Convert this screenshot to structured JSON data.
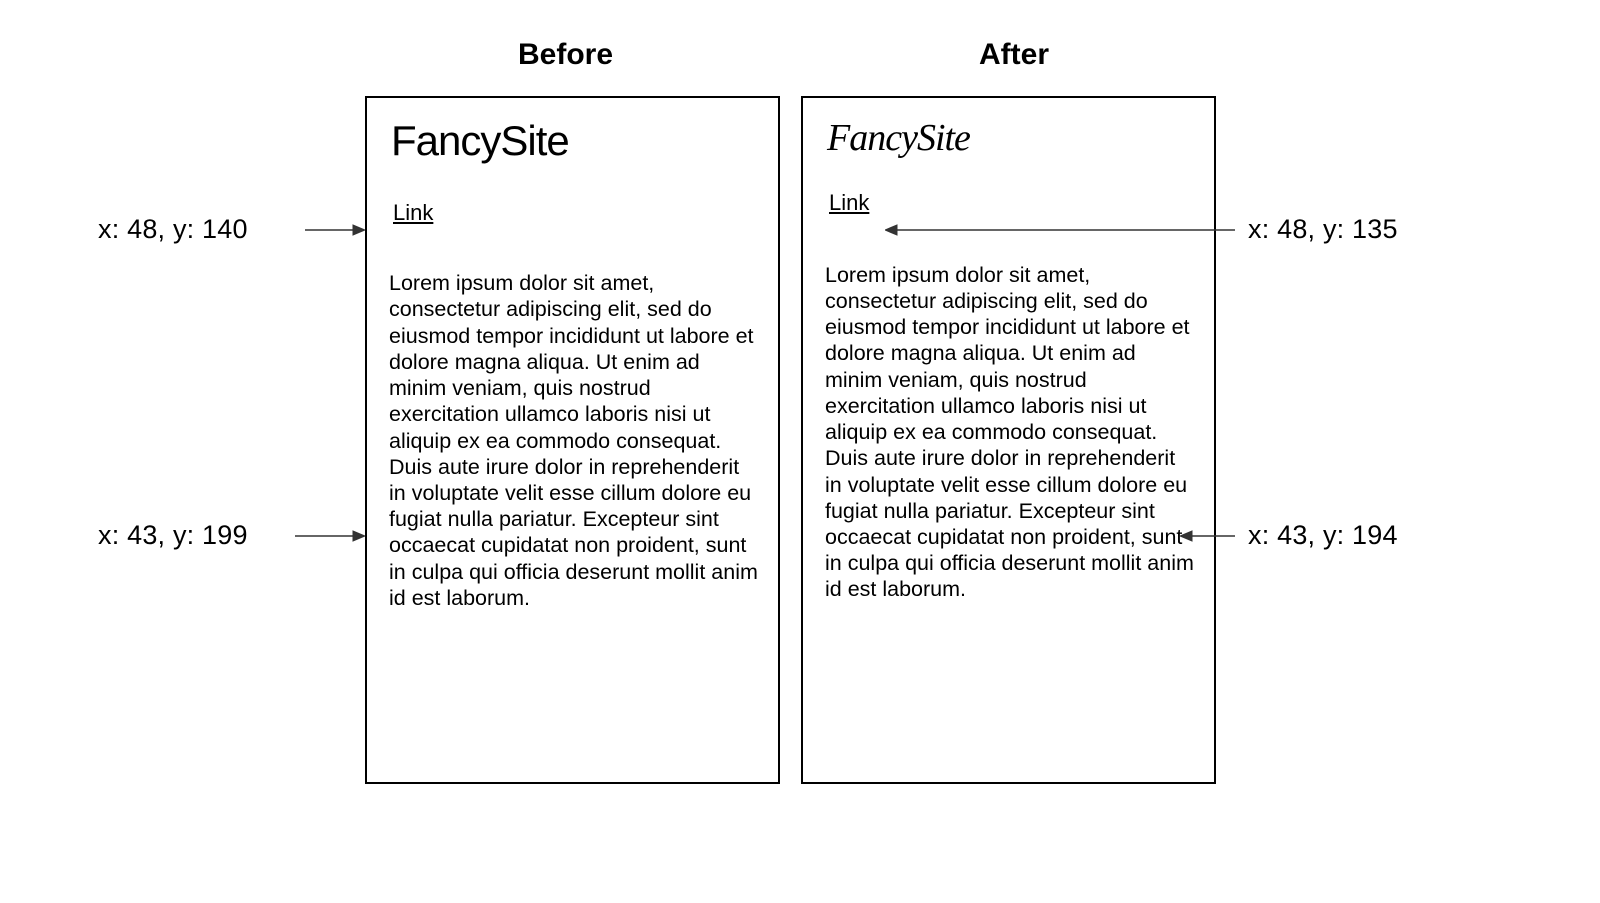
{
  "headers": {
    "before": "Before",
    "after": "After"
  },
  "site": {
    "title_before": "FancySite",
    "title_after": "FancySite"
  },
  "link_text": "Link",
  "body_text": "Lorem ipsum dolor sit amet, consectetur adipiscing elit, sed do eiusmod tempor incididunt ut labore et dolore magna aliqua. Ut enim ad minim veniam, quis nostrud exercitation ullamco laboris nisi ut aliquip ex ea commodo consequat. Duis aute irure dolor in reprehenderit in voluptate velit esse cillum dolore eu fugiat nulla pariatur. Excepteur sint occaecat cupidatat non proident, sunt in culpa qui officia deserunt mollit anim id est laborum.",
  "coords": {
    "before_link": "x: 48, y: 140",
    "before_body": "x: 43, y: 199",
    "after_link": "x: 48, y: 135",
    "after_body": "x: 43, y: 194"
  }
}
